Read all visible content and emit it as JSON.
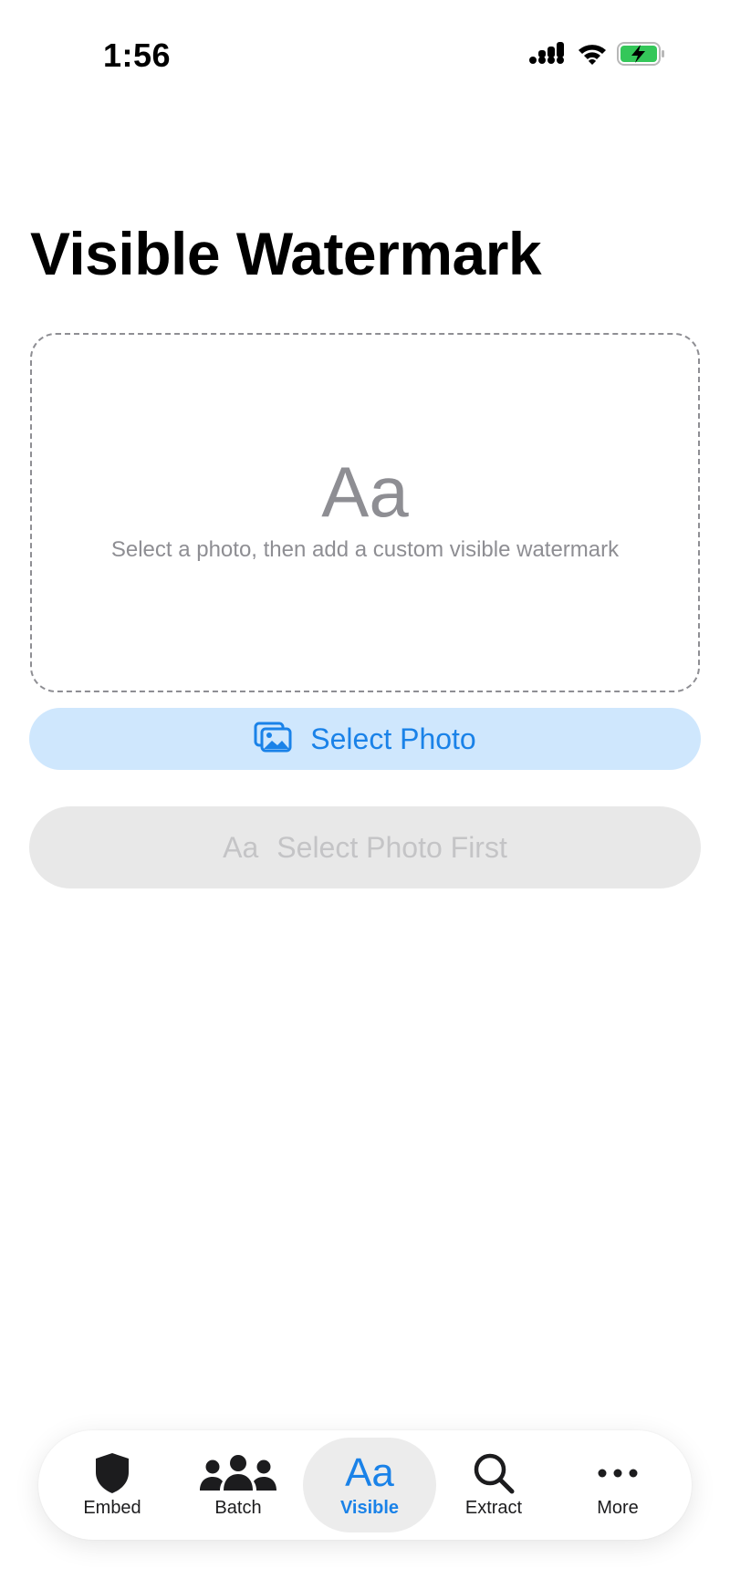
{
  "status_bar": {
    "time": "1:56",
    "icons": [
      "cellular-signal-icon",
      "wifi-icon",
      "battery-charging-icon"
    ],
    "battery_color": "#34c759"
  },
  "page": {
    "title": "Visible Watermark"
  },
  "drop_zone": {
    "glyph": "Aa",
    "hint": "Select a photo, then add a custom visible watermark"
  },
  "select_photo_button": {
    "icon": "photo-stack-icon",
    "label": "Select Photo"
  },
  "add_watermark_button": {
    "glyph": "Aa",
    "label": "Select Photo First",
    "enabled": false
  },
  "tab_bar": {
    "tabs": [
      {
        "label": "Embed",
        "icon": "shield-icon",
        "active": false
      },
      {
        "label": "Batch",
        "icon": "people-group-icon",
        "active": false
      },
      {
        "label": "Visible",
        "icon": "text-aa-icon",
        "glyph": "Aa",
        "active": true
      },
      {
        "label": "Extract",
        "icon": "magnifying-glass-icon",
        "active": false
      },
      {
        "label": "More",
        "icon": "ellipsis-icon",
        "active": false
      }
    ]
  },
  "colors": {
    "accent": "#1a82e8",
    "accent_light": "#cfe7fd",
    "disabled_bg": "#e8e8e8",
    "disabled_text": "#c4c4c6",
    "secondary_text": "#8e8e93"
  }
}
